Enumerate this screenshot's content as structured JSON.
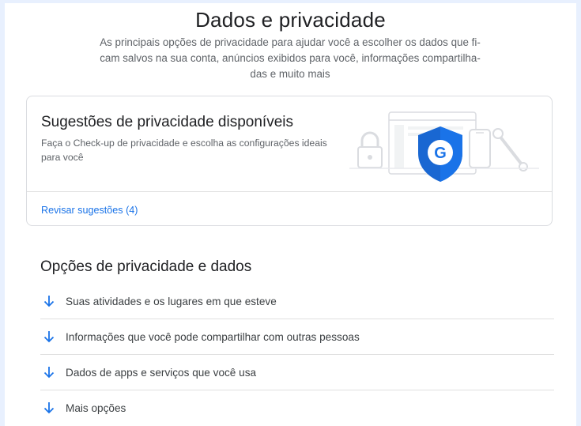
{
  "header": {
    "title": "Dados e privacidade",
    "subtitle": "As principais opções de privacidade para ajudar você a escolher os dados que fi­cam salvos na sua conta, anúncios exibidos para você, informações compartilha­das e muito mais"
  },
  "suggestions_card": {
    "title": "Sugestões de privacidade disponíveis",
    "description": "Faça o Check-up de privacidade e escolha as configurações ideais para você",
    "link_label": "Revisar sugestões (4)",
    "illustration_icons": [
      "lock-icon",
      "browser-window-icon",
      "google-shield-icon",
      "phone-icon",
      "wrench-icon"
    ]
  },
  "options_section": {
    "title": "Opções de privacidade e dados",
    "items": [
      {
        "label": "Suas atividades e os lugares em que esteve",
        "icon": "arrow-down-icon"
      },
      {
        "label": "Informações que você pode compartilhar com outras pessoas",
        "icon": "arrow-down-icon"
      },
      {
        "label": "Dados de apps e serviços que você usa",
        "icon": "arrow-down-icon"
      },
      {
        "label": "Mais opções",
        "icon": "arrow-down-icon"
      }
    ]
  },
  "colors": {
    "accent": "#1a73e8",
    "shield": "#1a73e8",
    "text_primary": "#202124",
    "text_secondary": "#5f6368",
    "divider": "#dadce0"
  }
}
